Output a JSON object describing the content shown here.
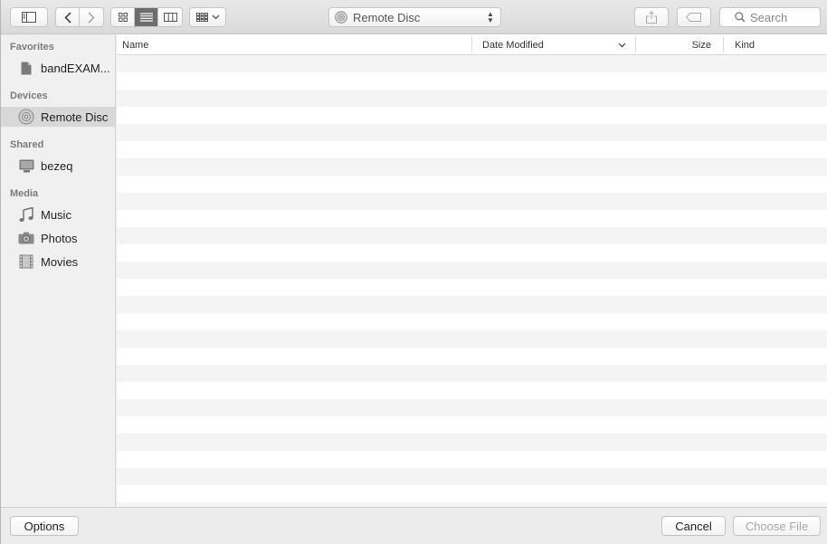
{
  "toolbar": {
    "sidebar_toggle_icon": "sidebar-icon",
    "back_icon": "chevron-left-icon",
    "forward_icon": "chevron-right-icon",
    "view_modes": [
      "icon-view",
      "list-view",
      "column-view"
    ],
    "active_view": "list-view",
    "arrange_icon": "arrange-grid-icon",
    "location": "Remote Disc",
    "share_icon": "share-icon",
    "tag_icon": "tag-icon",
    "search_placeholder": "Search"
  },
  "sidebar": {
    "sections": [
      {
        "title": "Favorites",
        "items": [
          {
            "label": "bandEXAM...",
            "icon": "document-icon"
          }
        ]
      },
      {
        "title": "Devices",
        "items": [
          {
            "label": "Remote Disc",
            "icon": "disc-icon",
            "selected": true
          }
        ]
      },
      {
        "title": "Shared",
        "items": [
          {
            "label": "bezeq",
            "icon": "computer-icon"
          }
        ]
      },
      {
        "title": "Media",
        "items": [
          {
            "label": "Music",
            "icon": "music-note-icon"
          },
          {
            "label": "Photos",
            "icon": "camera-icon"
          },
          {
            "label": "Movies",
            "icon": "film-icon"
          }
        ]
      }
    ]
  },
  "file_list": {
    "columns": {
      "name": "Name",
      "date_modified": "Date Modified",
      "size": "Size",
      "kind": "Kind"
    },
    "sort_column": "Date Modified",
    "sort_icon": "chevron-down-icon",
    "rows": []
  },
  "bottom_bar": {
    "options_label": "Options",
    "cancel_label": "Cancel",
    "choose_label": "Choose File",
    "choose_enabled": false
  },
  "colors": {
    "selected_sidebar": "#d8d8d8",
    "stripe": "#f4f4f4",
    "active_segment": "#6d6d6d"
  }
}
